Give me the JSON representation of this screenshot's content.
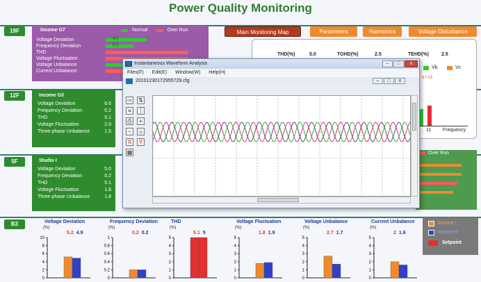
{
  "page_title": "Power Quality Monitoring",
  "floors": [
    {
      "id": "19F"
    },
    {
      "id": "12F"
    },
    {
      "id": "5F"
    },
    {
      "id": "B3"
    }
  ],
  "floor19": {
    "title": "Income G7",
    "legend_normal": "Normal",
    "legend_overrun": "Over Run",
    "rows": [
      {
        "label": "Voltage Deviation",
        "value": "4.5",
        "level": 0.45,
        "over": false
      },
      {
        "label": "Frequency Deviation",
        "value": "0.2",
        "level": 0.3,
        "over": false
      },
      {
        "label": "THD",
        "value": "",
        "level": 0.9,
        "over": true
      },
      {
        "label": "Voltage Fluctuation",
        "value": "",
        "level": 0.9,
        "over": true
      },
      {
        "label": "Voltage Unbalance",
        "value": "",
        "level": 0.85,
        "over": false
      },
      {
        "label": "Current Unbalance",
        "value": "",
        "level": 0.6,
        "over": true
      }
    ]
  },
  "floor12": {
    "title": "Income G3",
    "rows": [
      {
        "label": "Voltage Deviation",
        "value": "6.6"
      },
      {
        "label": "Frequency Deviation",
        "value": "0.2"
      },
      {
        "label": "THD",
        "value": "5.1"
      },
      {
        "label": "Voltage Fluctuation",
        "value": "2.0"
      },
      {
        "label": "Three-phase Unbalance",
        "value": "1.5"
      }
    ]
  },
  "floor5": {
    "title": "Studio I",
    "legend_overrun": "Over Run",
    "rows": [
      {
        "label": "Voltage Deviation",
        "value": "5.0"
      },
      {
        "label": "Frequency Deviation",
        "value": "0.2"
      },
      {
        "label": "THD",
        "value": "5.1"
      },
      {
        "label": "Voltage Fluctuation",
        "value": "1.8"
      },
      {
        "label": "Three-phase Unbalance",
        "value": "1.8"
      }
    ]
  },
  "nav": {
    "main_map": "Main Monitoring Map",
    "parameters": "Parameters",
    "harmonics": "Harmonics",
    "voltage_disturbance": "Voltage Disturbance"
  },
  "harmonics": {
    "thd_label": "THD(%)",
    "thd_value": "5.0",
    "tohd_label": "TOHD(%)",
    "tohd_value": "2.5",
    "tehd_label": "TEHD(%)",
    "tehd_value": "2.5",
    "vb": "Vb",
    "vc": "Vc",
    "xlabel": "Frequency",
    "tick": "11",
    "small": "3.7 2.5"
  },
  "window": {
    "title": "Instantaneous Waveform Analysis",
    "menu": [
      "Files(F)",
      "Edit(E)",
      "Window(W)",
      "Help(H)"
    ],
    "child_title": "20101230172955729.cfg"
  },
  "b3_legend": {
    "income1": "Income I",
    "income2": "Income II",
    "setpoint": "Setpoint"
  },
  "chart_data": [
    {
      "type": "bar",
      "title": "Voltage Deviation",
      "ylabel": "(%)",
      "ylim": [
        0,
        10
      ],
      "ticks": [
        "10",
        "8",
        "6",
        "4",
        "2",
        "0"
      ],
      "series": [
        {
          "name": "Income I",
          "values": [
            5.2
          ]
        },
        {
          "name": "Income II",
          "values": [
            4.9
          ]
        }
      ],
      "colors": [
        "#f08a2c",
        "#3140c8"
      ]
    },
    {
      "type": "bar",
      "title": "Frequency Deviation",
      "ylabel": "(%)",
      "ylim": [
        0,
        1
      ],
      "ticks": [
        "1",
        "0.8",
        "0.6",
        "0.4",
        "0.2",
        "0"
      ],
      "series": [
        {
          "name": "Income I",
          "values": [
            0.2
          ]
        },
        {
          "name": "Income II",
          "values": [
            0.2
          ]
        }
      ],
      "colors": [
        "#f08a2c",
        "#3140c8"
      ]
    },
    {
      "type": "bar",
      "title": "THD",
      "ylabel": "(%)",
      "ylim": [
        0,
        5
      ],
      "ticks": [
        "5",
        "4",
        "3",
        "2",
        "1",
        "0"
      ],
      "series": [
        {
          "name": "Income I",
          "values": [
            5.1
          ]
        },
        {
          "name": "Income II",
          "values": [
            5.0
          ]
        }
      ],
      "colors": [
        "#e52e2e",
        "#e52e2e"
      ]
    },
    {
      "type": "bar",
      "title": "Voltage Fluctuation",
      "ylabel": "(%)",
      "ylim": [
        0,
        5
      ],
      "ticks": [
        "5",
        "4",
        "3",
        "2",
        "1",
        "0"
      ],
      "series": [
        {
          "name": "Income I",
          "values": [
            1.8
          ]
        },
        {
          "name": "Income II",
          "values": [
            1.9
          ]
        }
      ],
      "colors": [
        "#f08a2c",
        "#3140c8"
      ]
    },
    {
      "type": "bar",
      "title": "Voltage Unbalance",
      "ylabel": "(%)",
      "ylim": [
        0,
        5
      ],
      "ticks": [
        "5",
        "4",
        "3",
        "2",
        "1",
        "0"
      ],
      "series": [
        {
          "name": "Income I",
          "values": [
            2.7
          ]
        },
        {
          "name": "Income II",
          "values": [
            1.7
          ]
        }
      ],
      "colors": [
        "#f08a2c",
        "#3140c8"
      ]
    },
    {
      "type": "bar",
      "title": "Current Unbalance",
      "ylabel": "(%)",
      "ylim": [
        0,
        5
      ],
      "ticks": [
        "5",
        "4",
        "3",
        "2",
        "1",
        "0"
      ],
      "series": [
        {
          "name": "Income I",
          "values": [
            2.0
          ]
        },
        {
          "name": "Income II",
          "values": [
            1.6
          ]
        }
      ],
      "colors": [
        "#f08a2c",
        "#3140c8"
      ]
    }
  ]
}
